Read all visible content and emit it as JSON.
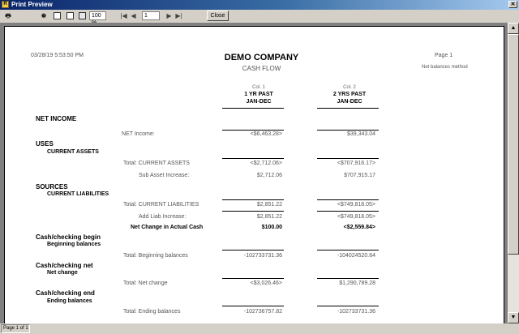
{
  "window": {
    "title": "Print Preview",
    "app_icon": "R"
  },
  "toolbar": {
    "zoom": "100 %",
    "page": "1",
    "close_label": "Close"
  },
  "status": {
    "text": "Page 1 of 1"
  },
  "report": {
    "timestamp": "03/28/19 5:53:50 PM",
    "company": "DEMO COMPANY",
    "title": "CASH FLOW",
    "page_label": "Page 1",
    "method": "Net balances method",
    "columns": [
      {
        "num": "Col. 1",
        "title": "1 YR PAST",
        "range": "JAN-DEC"
      },
      {
        "num": "Col. 2",
        "title": "2 YRS PAST",
        "range": "JAN-DEC"
      }
    ],
    "sections": {
      "net_income": "NET INCOME",
      "uses": "USES",
      "current_assets": "CURRENT ASSETS",
      "sources": "SOURCES",
      "current_liabilities": "CURRENT LIABILITIES",
      "cash_begin": "Cash/checking begin",
      "beginning_balances": "Beginning balances",
      "cash_net": "Cash/checking net",
      "net_change": "Net change",
      "cash_end": "Cash/checking end",
      "ending_balances": "Ending balances"
    },
    "rows": [
      {
        "label": "NET Income:",
        "v1": "<$6,463.28>",
        "v2": "$39,343.04"
      },
      {
        "label": "Total:  CURRENT ASSETS",
        "v1": "<$2,712.06>",
        "v2": "<$707,916.17>"
      },
      {
        "label": "Sub Asset Increase:",
        "v1": "$2,712.06",
        "v2": "$707,915.17"
      },
      {
        "label": "Total:  CURRENT LIABILITIES",
        "v1": "$2,851.22",
        "v2": "<$749,818.05>"
      },
      {
        "label": "Add Liab Increase:",
        "v1": "$2,851.22",
        "v2": "<$749,818.05>"
      },
      {
        "label": "Net Change in Actual Cash",
        "v1": "$100.00",
        "v2": "<$2,559.84>"
      },
      {
        "label": "Total:  Beginning balances",
        "v1": "-102733731.36",
        "v2": "-104024520.64"
      },
      {
        "label": "Total:  Net change",
        "v1": "<$3,026.46>",
        "v2": "$1,290,789.28"
      },
      {
        "label": "Total:  Ending balances",
        "v1": "-102736757.82",
        "v2": "-102733731.36"
      }
    ]
  }
}
